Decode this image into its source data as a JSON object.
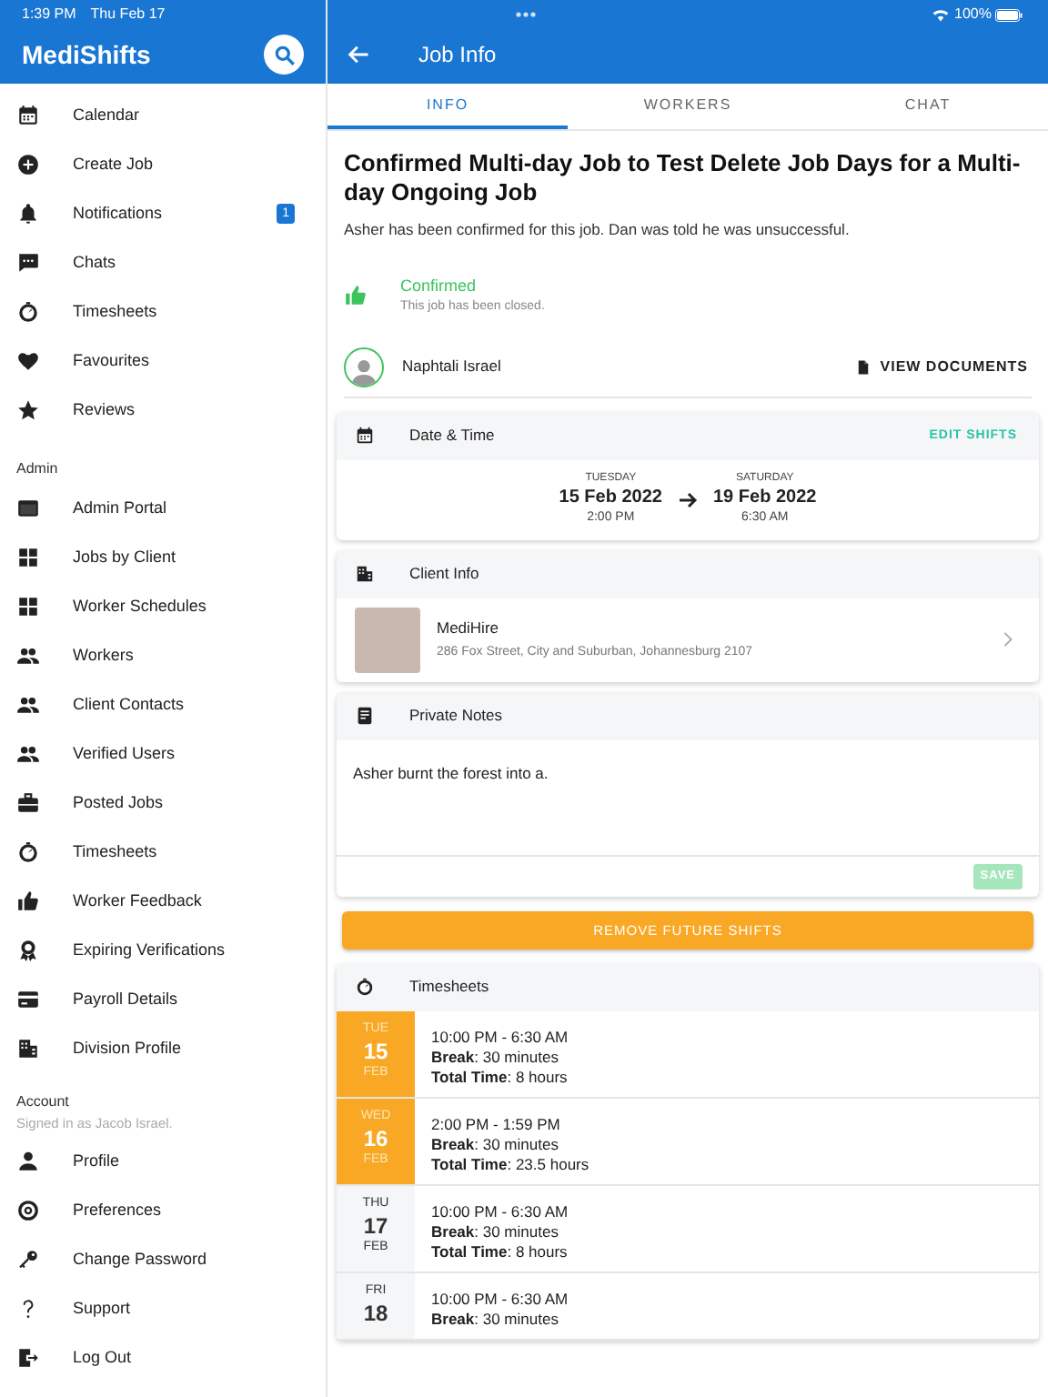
{
  "status_bar": {
    "time": "1:39 PM",
    "date": "Thu Feb 17",
    "battery": "100%"
  },
  "sidebar": {
    "title": "MediShifts",
    "sections": [
      {
        "items": [
          {
            "label": "Calendar"
          },
          {
            "label": "Create Job"
          },
          {
            "label": "Notifications",
            "badge": "1"
          },
          {
            "label": "Chats"
          },
          {
            "label": "Timesheets"
          },
          {
            "label": "Favourites"
          },
          {
            "label": "Reviews"
          }
        ]
      },
      {
        "heading": "Admin",
        "items": [
          {
            "label": "Admin Portal"
          },
          {
            "label": "Jobs by Client"
          },
          {
            "label": "Worker Schedules"
          },
          {
            "label": "Workers"
          },
          {
            "label": "Client Contacts"
          },
          {
            "label": "Verified Users"
          },
          {
            "label": "Posted Jobs"
          },
          {
            "label": "Timesheets"
          },
          {
            "label": "Worker Feedback"
          },
          {
            "label": "Expiring Verifications"
          },
          {
            "label": "Payroll Details"
          },
          {
            "label": "Division Profile"
          }
        ]
      },
      {
        "heading": "Account",
        "subheading": "Signed in as Jacob Israel.",
        "items": [
          {
            "label": "Profile"
          },
          {
            "label": "Preferences"
          },
          {
            "label": "Change Password"
          },
          {
            "label": "Support"
          },
          {
            "label": "Log Out"
          }
        ]
      }
    ]
  },
  "header": {
    "title": "Job Info"
  },
  "tabs": [
    {
      "label": "INFO",
      "selected": true
    },
    {
      "label": "WORKERS",
      "selected": false
    },
    {
      "label": "CHAT",
      "selected": false
    }
  ],
  "job": {
    "title": "Confirmed Multi-day Job to Test Delete Job Days for a Multi-day Ongoing Job",
    "summary": "Asher has been confirmed for this job. Dan was told he was unsuccessful.",
    "status": {
      "label": "Confirmed",
      "detail": "This job has been closed."
    },
    "worker": {
      "name": "Naphtali Israel"
    },
    "documents_button": "VIEW DOCUMENTS"
  },
  "date_time": {
    "title": "Date & Time",
    "action": "EDIT SHIFTS",
    "start": {
      "weekday": "TUESDAY",
      "date": "15 Feb 2022",
      "time": "2:00 PM"
    },
    "end": {
      "weekday": "SATURDAY",
      "date": "19 Feb 2022",
      "time": "6:30 AM"
    }
  },
  "client_info": {
    "title": "Client Info",
    "name": "MediHire",
    "address": "286 Fox Street, City and Suburban, Johannesburg 2107"
  },
  "private_notes": {
    "title": "Private Notes",
    "value": "Asher burnt the forest into a.",
    "save": "SAVE",
    "save_disabled": true
  },
  "remove_button": "REMOVE FUTURE SHIFTS",
  "timesheets": {
    "title": "Timesheets",
    "rows": [
      {
        "weekday": "TUE",
        "day": "15",
        "month": "FEB",
        "highlighted": true,
        "hours": "10:00 PM - 6:30 AM",
        "break": "**Break**: 30 minutes",
        "total": "**Total Time**: 8 hours"
      },
      {
        "weekday": "WED",
        "day": "16",
        "month": "FEB",
        "highlighted": true,
        "hours": "2:00 PM - 1:59 PM",
        "break": "**Break**: 30 minutes",
        "total": "**Total Time**: 23.5 hours"
      },
      {
        "weekday": "THU",
        "day": "17",
        "month": "FEB",
        "highlighted": false,
        "hours": "10:00 PM - 6:30 AM",
        "break": "**Break**: 30 minutes",
        "total": "**Total Time**: 8 hours"
      },
      {
        "weekday": "FRI",
        "day": "18",
        "highlighted": false,
        "hours": "10:00 PM - 6:30 AM",
        "break": "**Break**: 30 minutes"
      }
    ]
  }
}
